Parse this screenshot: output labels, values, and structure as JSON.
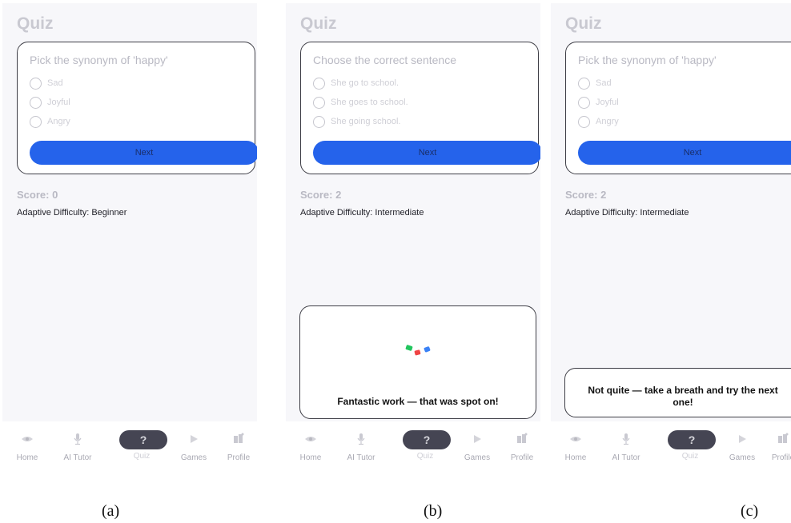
{
  "screens": [
    {
      "title": "Quiz",
      "question": "Pick the synonym of 'happy'",
      "options": [
        "Sad",
        "Joyful",
        "Angry"
      ],
      "next_label": "Next",
      "score": "Score: 0",
      "difficulty": "Adaptive Difficulty: Beginner",
      "caption": "(a)"
    },
    {
      "title": "Quiz",
      "question": "Choose the correct sentence",
      "options": [
        "She go to school.",
        "She goes to school.",
        "She going school."
      ],
      "next_label": "Next",
      "score": "Score: 2",
      "difficulty": "Adaptive Difficulty: Intermediate",
      "feedback": "Fantastic work — that was spot on!",
      "caption": "(b)"
    },
    {
      "title": "Quiz",
      "question": "Pick the synonym of 'happy'",
      "options": [
        "Sad",
        "Joyful",
        "Angry"
      ],
      "next_label": "Next",
      "score": "Score: 2",
      "difficulty": "Adaptive Difficulty: Intermediate",
      "feedback": "Not quite — take a breath and try the next one!",
      "caption": "(c)"
    }
  ],
  "nav": [
    {
      "label": "Home",
      "icon": "eye-icon"
    },
    {
      "label": "AI Tutor",
      "icon": "microphone-icon"
    },
    {
      "label": "Quiz",
      "icon": "question-icon",
      "glyph": "?"
    },
    {
      "label": "Games",
      "icon": "play-icon"
    },
    {
      "label": "Profile",
      "icon": "profile-icon"
    }
  ],
  "colors": {
    "accent": "#2563eb",
    "active_nav": "#454553",
    "confetti": [
      "#22c55e",
      "#ef4444",
      "#3b82f6"
    ]
  }
}
